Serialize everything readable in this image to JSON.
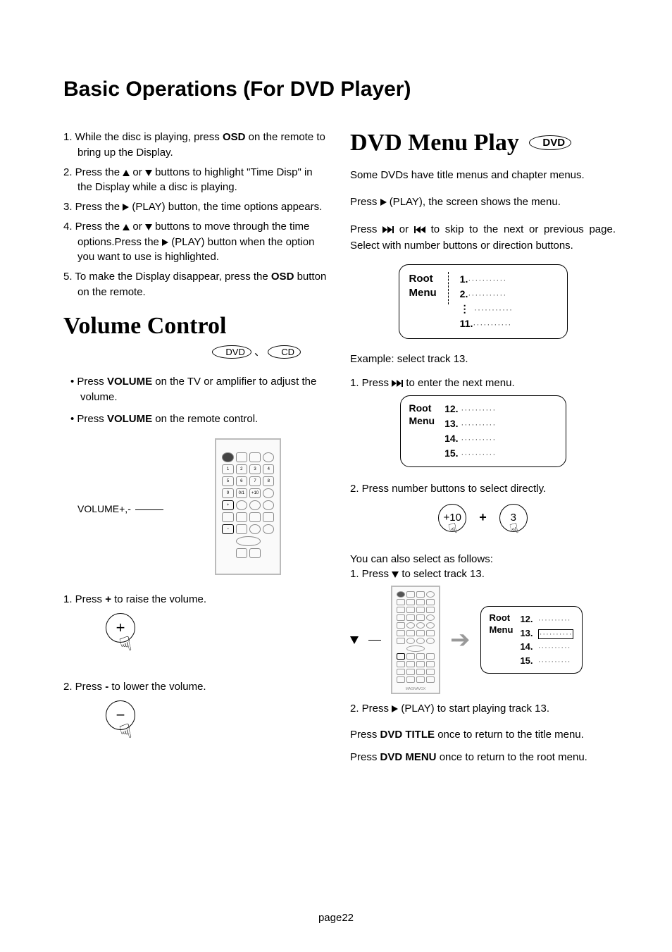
{
  "top_heading": "Basic Operations (For DVD Player)",
  "left": {
    "steps": {
      "s1_a": "1. While the disc is playing, press ",
      "s1_b": " on the remote to bring up the Display.",
      "s2_a": "2. Press the ",
      "s2_b": " or ",
      "s2_c": " buttons to highlight \"Time Disp\" in the Display while a disc is playing.",
      "s3_a": "3. Press the ",
      "s3_b": " (PLAY) button, the time options appears.",
      "s4_a": "4. Press the ",
      "s4_b": " or ",
      "s4_c": " buttons to move through the time options.Press the ",
      "s4_d": " (PLAY) button when the option you want to use is highlighted.",
      "s5_a": "5. To make the Display disappear, press the ",
      "s5_b": " button on the remote.",
      "osd": "OSD"
    },
    "vol_heading": "Volume Control",
    "disc_dvd": "DVD",
    "disc_cd": "CD",
    "vol_bullets": {
      "b1_a": "Press ",
      "b1_b": " on the TV or amplifier to adjust the volume.",
      "b2_a": "Press ",
      "b2_b": " on the remote control.",
      "volume": "VOLUME"
    },
    "vol_label": "VOLUME+,-",
    "vol_step1": "1. Press ",
    "vol_step1_sym": "+",
    "vol_step1_b": " to raise the volume.",
    "vol_step2": "2. Press ",
    "vol_step2_sym": "-",
    "vol_step2_b": " to lower the volume."
  },
  "right": {
    "heading": "DVD Menu Play",
    "disc_dvd": "DVD",
    "p1": "Some DVDs have title menus and chapter menus.",
    "p2_a": "Press ",
    "p2_b": " (PLAY), the screen shows the menu.",
    "p3_a": "Press ",
    "p3_b": " or ",
    "p3_c": " to skip to the next or previous page. Select with number buttons or direction buttons.",
    "menu1": {
      "label_a": "Root",
      "label_b": "Menu",
      "items": [
        "1.",
        "2.",
        "",
        "11."
      ]
    },
    "example": "Example: select track 13.",
    "step1_a": "1. Press ",
    "step1_b": " to enter the next menu.",
    "menu2": {
      "label_a": "Root",
      "label_b": "Menu",
      "items": [
        "12.",
        "13.",
        "14.",
        "15."
      ]
    },
    "step2": "2. Press number buttons to select directly.",
    "btn_plus10": "+10",
    "btn_3": "3",
    "alt": "You can also select  as follows:",
    "alt1_a": "1. Press ",
    "alt1_b": " to select track 13.",
    "menu3": {
      "label_a": "Root",
      "label_b": "Menu",
      "items": [
        "12.",
        "13.",
        "14.",
        "15."
      ]
    },
    "alt2_a": "2. Press ",
    "alt2_b": " (PLAY) to start playing track 13.",
    "foot1_a": "Press ",
    "foot1_key": "DVD TITLE",
    "foot1_b": " once to return to the title menu.",
    "foot2_a": "Press ",
    "foot2_key": "DVD MENU",
    "foot2_b": " once to return to the root menu."
  },
  "page_num": "page22"
}
